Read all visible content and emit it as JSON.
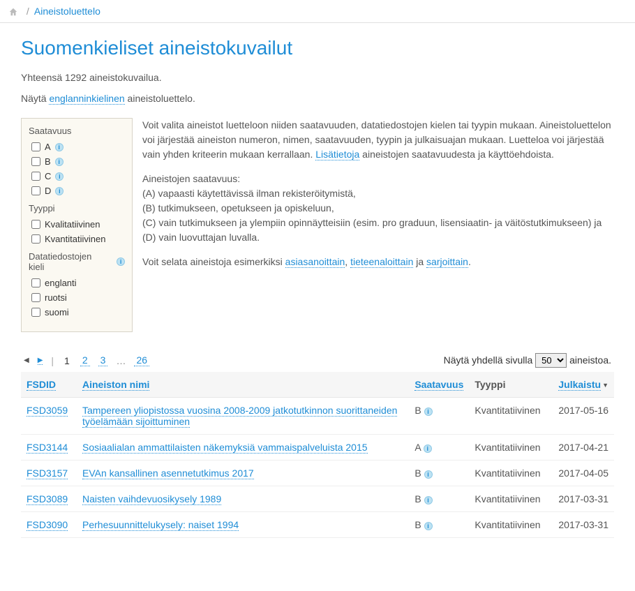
{
  "breadcrumb": {
    "text": "Aineistoluettelo"
  },
  "title": "Suomenkieliset aineistokuvailut",
  "summary": "Yhteensä 1292 aineistokuvailua.",
  "lang_line": {
    "pre": "Näytä ",
    "link": "englanninkielinen",
    "post": " aineistoluettelo."
  },
  "filters": {
    "avail_label": "Saatavuus",
    "avail": [
      {
        "label": "A"
      },
      {
        "label": "B"
      },
      {
        "label": "C"
      },
      {
        "label": "D"
      }
    ],
    "type_label": "Tyyppi",
    "types": [
      {
        "label": "Kvalitatiivinen"
      },
      {
        "label": "Kvantitatiivinen"
      }
    ],
    "lang_label": "Datatiedostojen kieli",
    "langs": [
      {
        "label": "englanti"
      },
      {
        "label": "ruotsi"
      },
      {
        "label": "suomi"
      }
    ]
  },
  "intro": {
    "p1_a": "Voit valita aineistot luetteloon niiden saatavuuden, datatiedostojen kielen tai tyypin mukaan. Aineistoluettelon voi järjestää aineiston numeron, nimen, saatavuuden, tyypin ja julkaisuajan mukaan. Luetteloa voi järjestää vain yhden kriteerin mukaan kerrallaan. ",
    "p1_link": "Lisätietoja",
    "p1_b": " aineistojen saatavuudesta ja käyttöehdoista.",
    "p2": "Aineistojen saatavuus:\n(A) vapaasti käytettävissä ilman rekisteröitymistä,\n(B) tutkimukseen, opetukseen ja opiskeluun,\n(C) vain tutkimukseen ja ylempiin opinnäytteisiin (esim. pro graduun, lisensiaatin- ja väitöstutkimukseen) ja\n(D) vain luovuttajan luvalla.",
    "p3_a": "Voit selata aineistoja esimerkiksi ",
    "p3_l1": "asiasanoittain",
    "p3_sep1": ", ",
    "p3_l2": "tieteenaloittain",
    "p3_sep2": " ja ",
    "p3_l3": "sarjoittain",
    "p3_end": "."
  },
  "pager": {
    "current": "1",
    "pages": [
      "2",
      "3"
    ],
    "ellipsis": "…",
    "last": "26",
    "right_pre": "Näytä yhdellä sivulla ",
    "select": "50",
    "right_post": " aineistoa."
  },
  "headers": {
    "fsdid": "FSDID",
    "name": "Aineiston nimi",
    "avail": "Saatavuus",
    "type": "Tyyppi",
    "published": "Julkaistu"
  },
  "rows": [
    {
      "id": "FSD3059",
      "name": "Tampereen yliopistossa vuosina 2008-2009 jatkotutkinnon suorittaneiden työelämään sijoittuminen",
      "avail": "B",
      "type": "Kvantitatiivinen",
      "date": "2017-05-16"
    },
    {
      "id": "FSD3144",
      "name": "Sosiaalialan ammattilaisten näkemyksiä vammaispalveluista 2015",
      "avail": "A",
      "type": "Kvantitatiivinen",
      "date": "2017-04-21"
    },
    {
      "id": "FSD3157",
      "name": "EVAn kansallinen asennetutkimus 2017",
      "avail": "B",
      "type": "Kvantitatiivinen",
      "date": "2017-04-05"
    },
    {
      "id": "FSD3089",
      "name": "Naisten vaihdevuosikysely 1989",
      "avail": "B",
      "type": "Kvantitatiivinen",
      "date": "2017-03-31"
    },
    {
      "id": "FSD3090",
      "name": "Perhesuunnittelukysely: naiset 1994",
      "avail": "B",
      "type": "Kvantitatiivinen",
      "date": "2017-03-31"
    }
  ]
}
